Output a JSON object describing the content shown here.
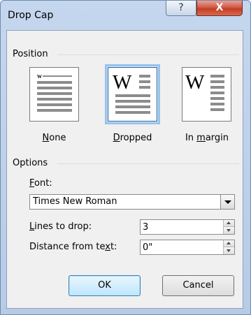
{
  "dialog": {
    "title": "Drop Cap",
    "help_glyph": "?",
    "close_glyph": "X"
  },
  "position": {
    "group_label": "Position",
    "options": [
      {
        "label_pre": "",
        "label_ul": "N",
        "label_post": "one",
        "selected": false
      },
      {
        "label_pre": "",
        "label_ul": "D",
        "label_post": "ropped",
        "selected": true
      },
      {
        "label_pre": "In ",
        "label_ul": "m",
        "label_post": "argin",
        "selected": false
      }
    ],
    "preview_letter": "W"
  },
  "options": {
    "group_label": "Options",
    "font_label_ul": "F",
    "font_label_post": "ont:",
    "font_value": "Times New Roman",
    "lines_label_ul": "L",
    "lines_label_post": "ines to drop:",
    "lines_value": "3",
    "distance_label_pre": "Distance from te",
    "distance_label_ul": "x",
    "distance_label_post": "t:",
    "distance_value": "0\""
  },
  "buttons": {
    "ok": "OK",
    "cancel": "Cancel"
  },
  "colors": {
    "selection_outline": "#95c3ea",
    "close_button": "#c33d26",
    "window_frame": "#b7cbe6"
  }
}
